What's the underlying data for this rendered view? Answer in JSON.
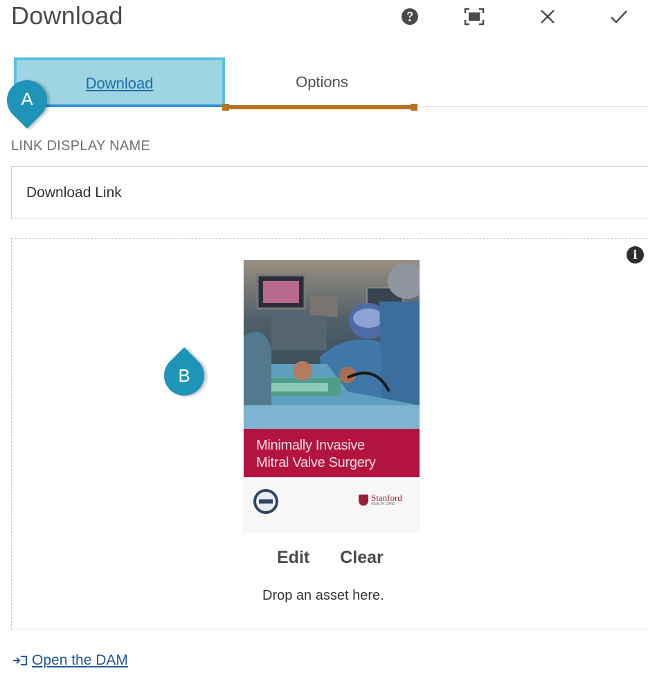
{
  "dialog": {
    "title": "Download",
    "toolbar": {
      "help_icon": "help-icon",
      "fullscreen_icon": "fullscreen-icon",
      "close_icon": "close-icon",
      "done_icon": "checkmark-icon"
    }
  },
  "tabs": [
    {
      "label": "Download",
      "active": true
    },
    {
      "label": "Options",
      "active": false
    }
  ],
  "callouts": {
    "a": "A",
    "b": "B",
    "color": "#1d94b8"
  },
  "link_field": {
    "label": "LINK DISPLAY NAME",
    "value": "Download Link"
  },
  "asset": {
    "caption_line1": "Minimally Invasive",
    "caption_line2": "Mitral Valve Surgery",
    "logo_text": "Stanford",
    "logo_subtext": "HEALTH CARE",
    "actions": {
      "edit": "Edit",
      "clear": "Clear"
    },
    "drop_hint": "Drop an asset here.",
    "info_icon": "info-icon"
  },
  "footer": {
    "open_dam": "Open the DAM",
    "open_dam_icon": "external-link-icon"
  },
  "colors": {
    "active_tab_fill": "#9fd4e3",
    "active_tab_border": "#5bc2dc",
    "options_highlight": "#b7711f",
    "caption_band": "#b3143f",
    "link": "#1d5a9e"
  }
}
